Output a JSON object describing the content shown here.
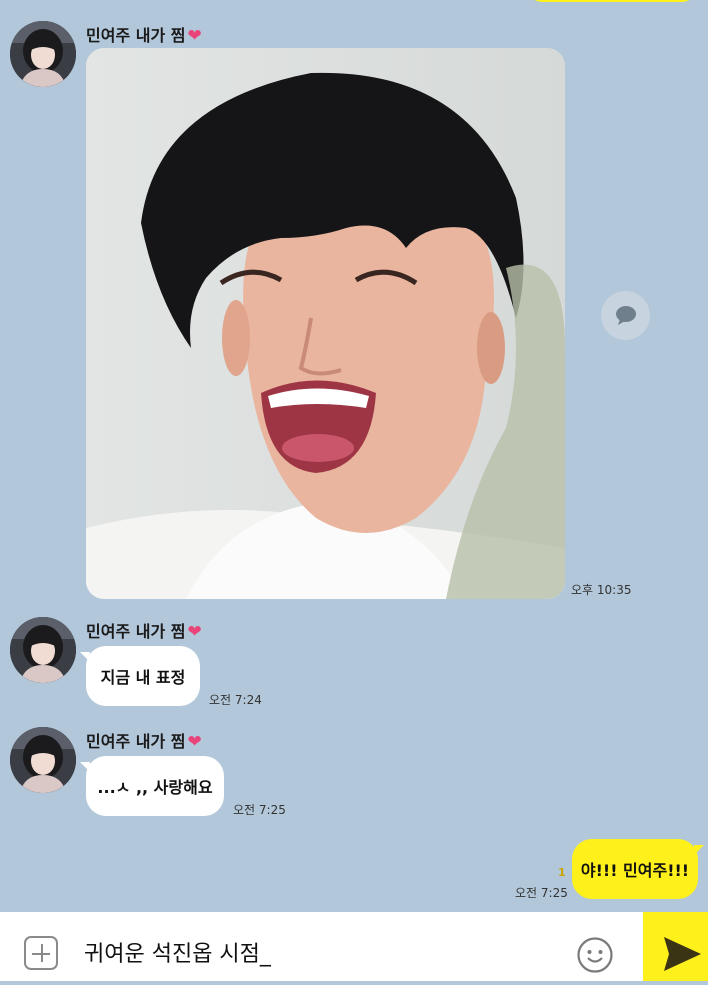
{
  "messages": [
    {
      "sender_name": "민여주 내가 찜",
      "sender_suffix": "❤",
      "type": "photo",
      "photo_subject": "laughing-man",
      "time": "오후 10:35"
    },
    {
      "sender_name": "민여주 내가 찜",
      "sender_suffix": "❤",
      "type": "text",
      "text": "지금 내 표정",
      "time": "오전 7:24"
    },
    {
      "sender_name": "민여주 내가 찜",
      "sender_suffix": "❤",
      "type": "text",
      "text": "...ㅅ ,, 사랑해요",
      "time": "오전 7:25"
    },
    {
      "sender_name": "",
      "type": "text",
      "outgoing": true,
      "text": "야!!! 민여주!!!",
      "unread_count": "1",
      "time": "오전 7:25"
    }
  ],
  "input": {
    "value": "귀여운 석진옵 시점_"
  },
  "icons": {
    "attach": "plus-icon",
    "emoji": "emoji-icon",
    "send": "send-icon",
    "share": "chat-bubble-icon"
  },
  "colors": {
    "background": "#b2c7da",
    "incoming_bubble": "#ffffff",
    "outgoing_bubble": "#fef01b",
    "heart": "#e8447a"
  }
}
